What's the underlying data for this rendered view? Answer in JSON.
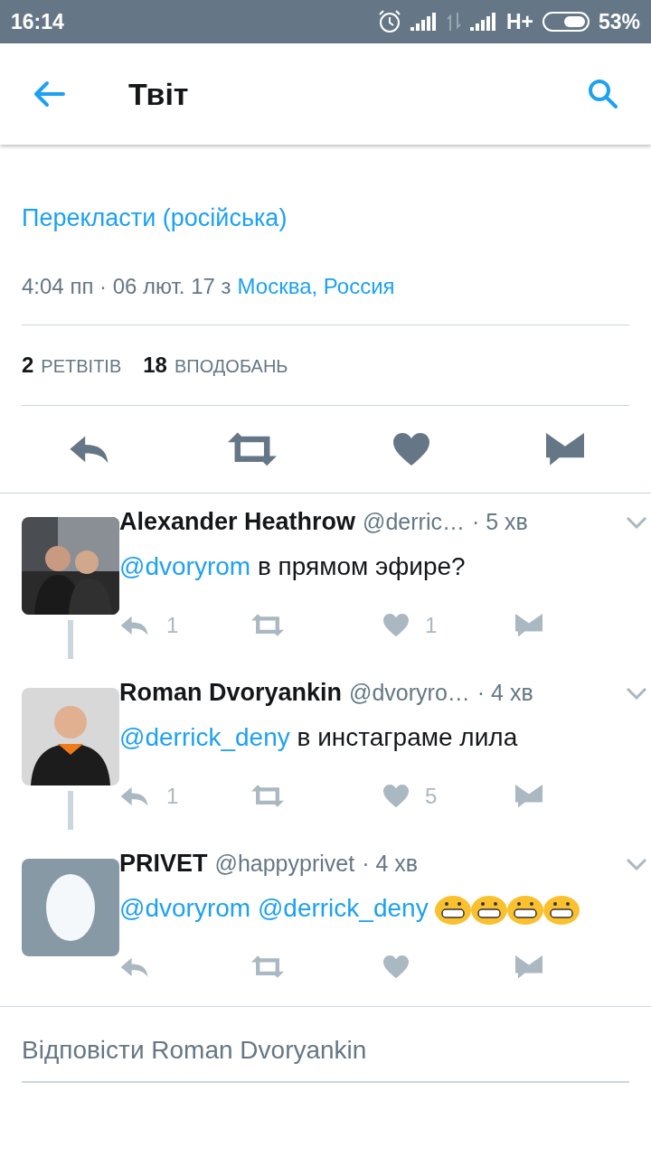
{
  "status_bar": {
    "time": "16:14",
    "network": "H+",
    "battery": "53%"
  },
  "header": {
    "title": "Твіт"
  },
  "tweet": {
    "translate_link": "Перекласти (російська)",
    "timestamp": "4:04 пп · 06 лют. 17 з",
    "location": "Москва, Россия",
    "stats": [
      {
        "count": "2",
        "label": "РЕТВІТІВ"
      },
      {
        "count": "18",
        "label": "ВПОДОБАНЬ"
      }
    ]
  },
  "replies": [
    {
      "avatar": {
        "kind": "picture"
      },
      "name": "Alexander Heathrow",
      "handle": "@derric…",
      "time": "· 5 хв",
      "mentions": [
        "@dvoryrom"
      ],
      "text": "в прямом эфире?",
      "reply_count": "1",
      "like_count": "1",
      "thread_line": true
    },
    {
      "avatar": {
        "kind": "picture"
      },
      "name": "Roman Dvoryankin",
      "handle": "@dvoryro…",
      "time": "· 4 хв",
      "mentions": [
        "@derrick_deny"
      ],
      "text": "в инстаграме лила",
      "reply_count": "1",
      "like_count": "5",
      "thread_line": true
    },
    {
      "avatar": {
        "kind": "egg"
      },
      "name": "PRIVET",
      "handle": "@happyprivet",
      "time": "· 4 хв",
      "mentions": [
        "@dvoryrom",
        "@derrick_deny"
      ],
      "emojis": [
        {
          "kind": "grin"
        },
        {
          "kind": "grin"
        },
        {
          "kind": "grin"
        },
        {
          "kind": "grin"
        }
      ],
      "thread_line": false
    }
  ],
  "reply_box": {
    "placeholder": "Відповісти Roman Dvoryankin"
  }
}
